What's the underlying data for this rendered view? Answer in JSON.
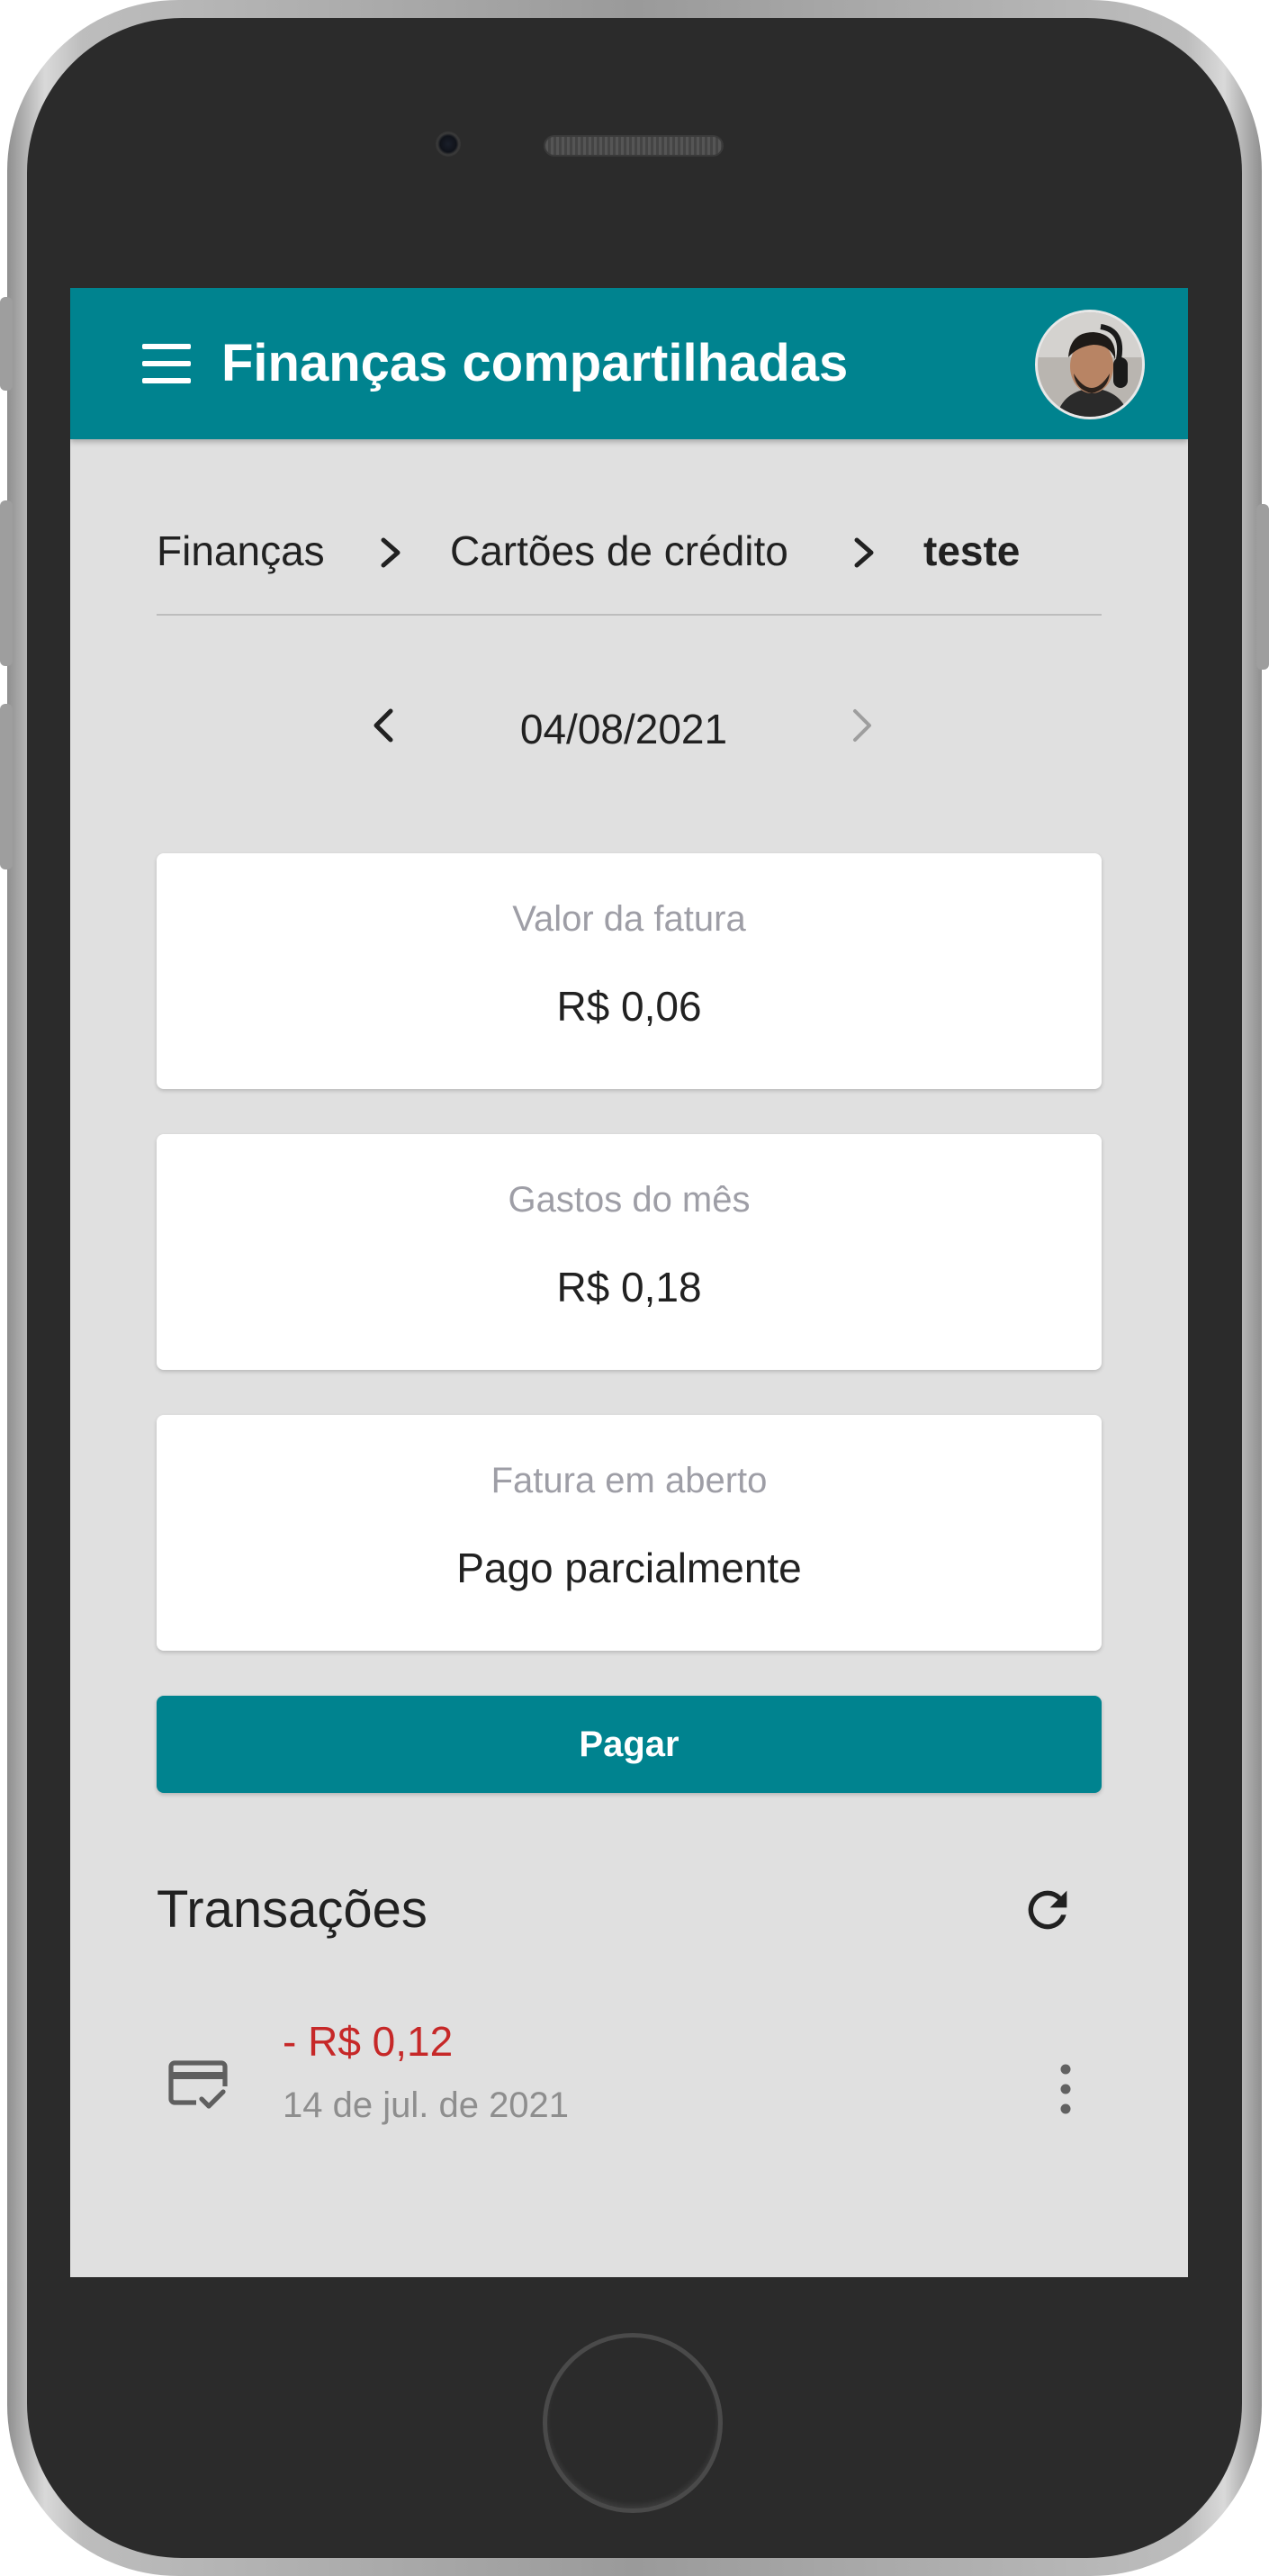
{
  "app": {
    "title": "Finanças compartilhadas"
  },
  "breadcrumb": {
    "items": [
      {
        "label": "Finanças"
      },
      {
        "label": "Cartões de crédito"
      },
      {
        "label": "teste"
      }
    ]
  },
  "date_nav": {
    "label": "04/08/2021",
    "next_enabled": false
  },
  "cards": [
    {
      "label": "Valor da fatura",
      "value": "R$ 0,06"
    },
    {
      "label": "Gastos do mês",
      "value": "R$ 0,18"
    },
    {
      "label": "Fatura em aberto",
      "value": "Pago parcialmente"
    }
  ],
  "actions": {
    "pay_label": "Pagar"
  },
  "transactions": {
    "title": "Transações",
    "items": [
      {
        "amount": "- R$ 0,12",
        "date": "14 de jul. de 2021",
        "icon": "credit-card-check-icon"
      }
    ]
  },
  "colors": {
    "primary": "#00838f",
    "background": "#e0e0e0",
    "negative": "#c62828",
    "muted": "#9e9ea6"
  }
}
